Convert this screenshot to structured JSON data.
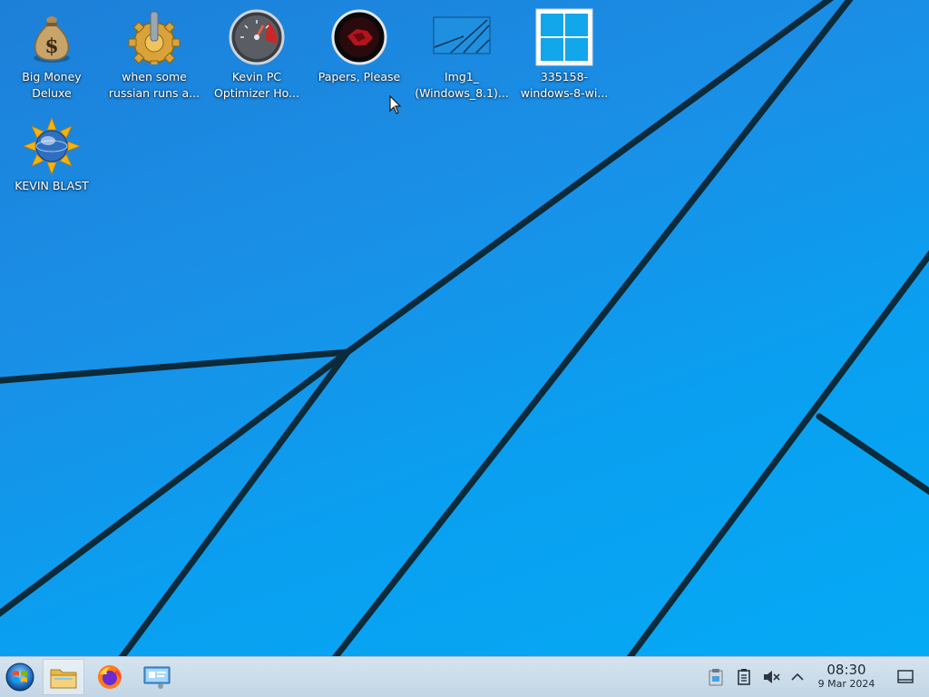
{
  "desktop": {
    "icons": [
      {
        "name": "big-money-deluxe",
        "line1": "Big Money",
        "line2": "Deluxe"
      },
      {
        "name": "when-some-russian",
        "line1": "when some",
        "line2": "russian runs a..."
      },
      {
        "name": "kevin-pc-optimizer",
        "line1": "Kevin PC",
        "line2": "Optimizer Ho..."
      },
      {
        "name": "papers-please",
        "line1": "Papers, Please",
        "line2": ""
      },
      {
        "name": "img1-windows",
        "line1": "Img1_",
        "line2": "(Windows_8.1)..."
      },
      {
        "name": "windows-8-wallpaper",
        "line1": "335158-",
        "line2": "windows-8-wi..."
      },
      {
        "name": "kevin-blast",
        "line1": "KEVIN BLAST",
        "line2": ""
      }
    ],
    "accent_color": "#1a8fe6"
  },
  "taskbar": {
    "start_icon": "windows-orb-icon",
    "pinned": [
      {
        "icon": "file-manager-icon",
        "active": true
      },
      {
        "icon": "firefox-icon",
        "active": false
      },
      {
        "icon": "system-settings-icon",
        "active": false
      }
    ],
    "tray": [
      "clipboard-manager-icon",
      "notes-icon",
      "volume-muted-icon",
      "chevron-up-icon"
    ],
    "clock": {
      "time": "08:30",
      "date": "9 Mar 2024"
    },
    "show_desktop_icon": "show-desktop-icon"
  }
}
